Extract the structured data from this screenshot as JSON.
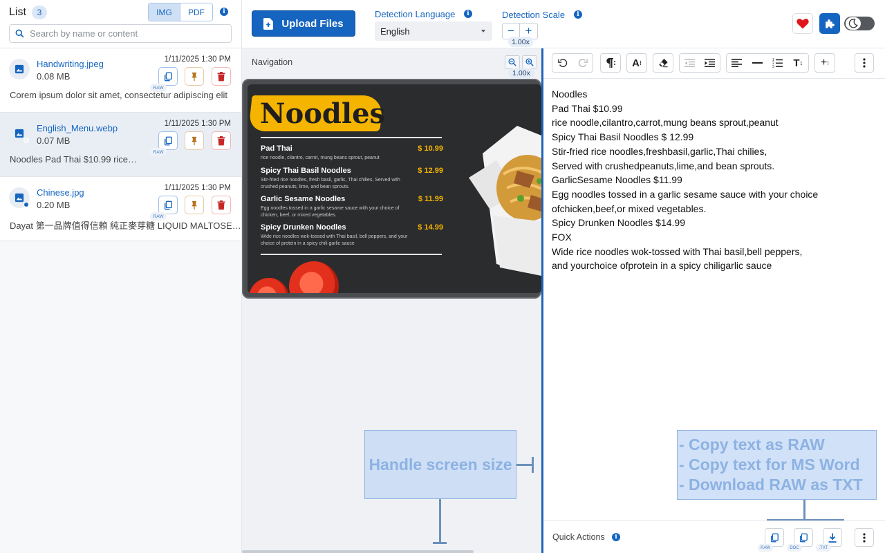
{
  "sidebar": {
    "title": "List",
    "count": "3",
    "tabs": [
      "IMG",
      "PDF"
    ],
    "search_placeholder": "Search by name or content",
    "files": [
      {
        "name": "Handwriting.jpeg",
        "size": "0.08 MB",
        "date": "1/11/2025 1:30 PM",
        "preview": "Corem ipsum dolor sit amet, consectetur adipiscing elit",
        "raw": "RAW"
      },
      {
        "name": "English_Menu.webp",
        "size": "0.07 MB",
        "date": "1/11/2025 1:30 PM",
        "preview": "Noodles Pad Thai $10.99 rice…",
        "raw": "RAW"
      },
      {
        "name": "Chinese.jpg",
        "size": "0.20 MB",
        "date": "1/11/2025 1:30 PM",
        "preview": "Dayat 第一品牌值得信賴 純正麥芽糖 LIQUID MALTOSE…",
        "raw": "RAW"
      }
    ]
  },
  "toolbar": {
    "upload_label": "Upload Files",
    "detection_language_label": "Detection Language",
    "language_value": "English",
    "detection_scale_label": "Detection Scale",
    "scale_value": "1.00x"
  },
  "navigation": {
    "title": "Navigation",
    "zoom_value": "1.00x",
    "menu": {
      "title": "Noodles",
      "items": [
        {
          "name": "Pad Thai",
          "price": "$ 10.99",
          "desc": "rice noodle, cilantro, carrot, mung beans sprout, peanut"
        },
        {
          "name": "Spicy Thai Basil Noodles",
          "price": "$ 12.99",
          "desc": "Stir-fried rice noodles, fresh basil, garlic, Thai chilies, Served with crushed peanuts, lime, and bean sprouts."
        },
        {
          "name": "Garlic Sesame Noodles",
          "price": "$ 11.99",
          "desc": "Egg noodles tossed in a garlic sesame sauce with your choice of chicken, beef, or mixed vegetables."
        },
        {
          "name": "Spicy Drunken Noodles",
          "price": "$ 14.99",
          "desc": "Wide rice noodles wok-tossed with Thai basil, bell peppers, and your choice of protein in a spicy chili garlic sauce"
        }
      ]
    },
    "annotation": "Handle screen size"
  },
  "editor": {
    "text_lines": [
      "Noodles",
      "Pad Thai $10.99",
      "rice noodle,cilantro,carrot,mung beans sprout,peanut",
      "Spicy Thai Basil Noodles $ 12.99",
      "Stir-fried rice noodles,freshbasil,garlic,Thai chilies,",
      "Served with crushedpeanuts,lime,and bean sprouts.",
      "GarlicSesame Noodles $11.99",
      "Egg noodles tossed in a garlic sesame sauce with your choice",
      "ofchicken,beef,or mixed vegetables.",
      "Spicy Drunken Noodles $14.99",
      "FOX",
      "Wide rice noodles wok-tossed with Thai basil,bell peppers,",
      "and yourchoice ofprotein in a spicy chiligarlic sauce"
    ],
    "annotation_lines": [
      "- Copy text as RAW",
      "- Copy text for MS Word",
      "- Download RAW as TXT"
    ],
    "quick_actions_label": "Quick Actions",
    "quick_tags": [
      "RAW",
      "DOC",
      ".TXT"
    ]
  },
  "colors": {
    "accent": "#1565c0",
    "pin": "#b8731c",
    "delete": "#c62828",
    "heart": "#e0161b"
  },
  "icons": [
    "search-icon",
    "info-icon",
    "image-icon",
    "copy-icon",
    "pin-icon",
    "trash-icon",
    "upload-file-icon",
    "heart-icon",
    "puzzle-icon",
    "moon-icon",
    "zoom-out-icon",
    "zoom-in-icon",
    "undo-icon",
    "redo-icon",
    "paragraph-icon",
    "font-size-icon",
    "eraser-icon",
    "outdent-icon",
    "indent-icon",
    "align-left-icon",
    "horizontal-rule-icon",
    "numbered-list-icon",
    "text-height-icon",
    "insert-icon",
    "more-icon",
    "download-icon"
  ]
}
